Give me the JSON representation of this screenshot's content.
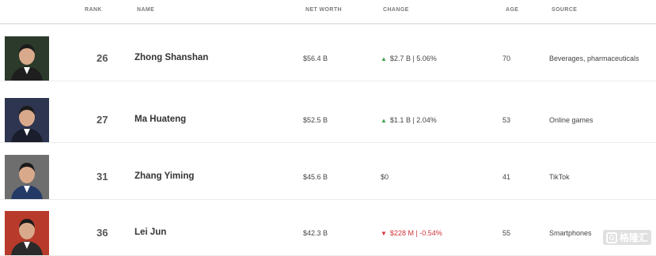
{
  "columns": {
    "rank": "RANK",
    "name": "NAME",
    "net_worth": "NET WORTH",
    "change": "CHANGE",
    "age": "AGE",
    "source": "SOURCE"
  },
  "rows": [
    {
      "rank": "26",
      "name": "Zhong Shanshan",
      "net_worth": "$56.4 B",
      "change_dir": "up",
      "change": "$2.7 B | 5.06%",
      "age": "70",
      "source": "Beverages, pharmaceuticals",
      "photo_icon": "person-photo"
    },
    {
      "rank": "27",
      "name": "Ma Huateng",
      "net_worth": "$52.5 B",
      "change_dir": "up",
      "change": "$1.1 B | 2.04%",
      "age": "53",
      "source": "Online games",
      "photo_icon": "person-photo"
    },
    {
      "rank": "31",
      "name": "Zhang Yiming",
      "net_worth": "$45.6 B",
      "change_dir": "none",
      "change": "$0",
      "age": "41",
      "source": "TikTok",
      "photo_icon": "person-photo"
    },
    {
      "rank": "36",
      "name": "Lei Jun",
      "net_worth": "$42.3 B",
      "change_dir": "down",
      "change": "$228 M | -0.54%",
      "age": "55",
      "source": "Smartphones",
      "photo_icon": "person-photo"
    }
  ],
  "icons": {
    "up": "▲",
    "down": "▼"
  },
  "colors": {
    "up": "#3fa34d",
    "down": "#d0343a"
  },
  "watermark": {
    "text": "格隆汇",
    "icon": "g-logo-icon"
  }
}
